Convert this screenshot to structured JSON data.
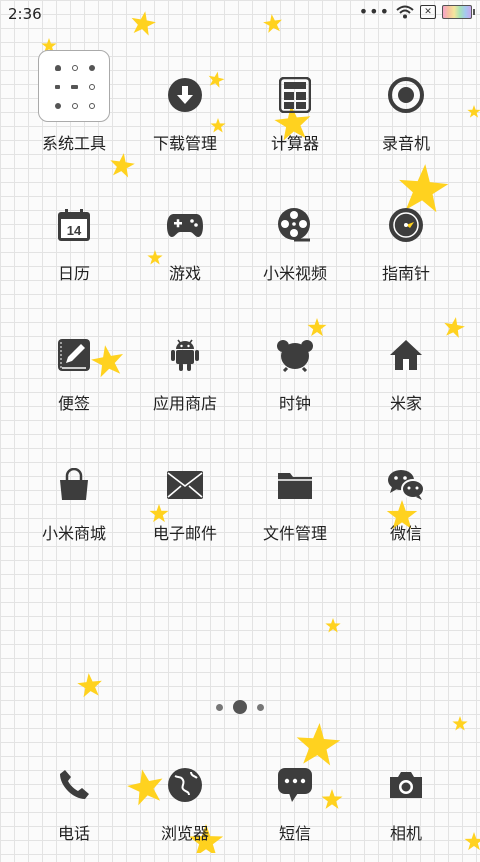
{
  "status_bar": {
    "time": "2:36",
    "dots": "•••"
  },
  "apps": [
    {
      "label": "系统工具",
      "icon": "folder-icon"
    },
    {
      "label": "下载管理",
      "icon": "download-icon"
    },
    {
      "label": "计算器",
      "icon": "calculator-icon"
    },
    {
      "label": "录音机",
      "icon": "record-icon"
    },
    {
      "label": "日历",
      "icon": "calendar-icon",
      "badge": "14"
    },
    {
      "label": "游戏",
      "icon": "gamepad-icon"
    },
    {
      "label": "小米视频",
      "icon": "film-reel-icon"
    },
    {
      "label": "指南针",
      "icon": "compass-icon"
    },
    {
      "label": "便签",
      "icon": "notes-icon"
    },
    {
      "label": "应用商店",
      "icon": "android-icon"
    },
    {
      "label": "时钟",
      "icon": "clock-icon"
    },
    {
      "label": "米家",
      "icon": "home-icon"
    },
    {
      "label": "小米商城",
      "icon": "shopping-bag-icon"
    },
    {
      "label": "电子邮件",
      "icon": "mail-icon"
    },
    {
      "label": "文件管理",
      "icon": "file-folder-icon"
    },
    {
      "label": "微信",
      "icon": "wechat-icon"
    }
  ],
  "dock": [
    {
      "label": "电话",
      "icon": "phone-icon"
    },
    {
      "label": "浏览器",
      "icon": "globe-icon"
    },
    {
      "label": "短信",
      "icon": "message-icon"
    },
    {
      "label": "相机",
      "icon": "camera-icon"
    }
  ],
  "pager": {
    "page_count": 3,
    "active_index": 1
  },
  "colors": {
    "icon": "#3d3d3d",
    "star": "#ffd21f",
    "grid_line": "#e3e3e3",
    "background": "#fbfbfb"
  }
}
